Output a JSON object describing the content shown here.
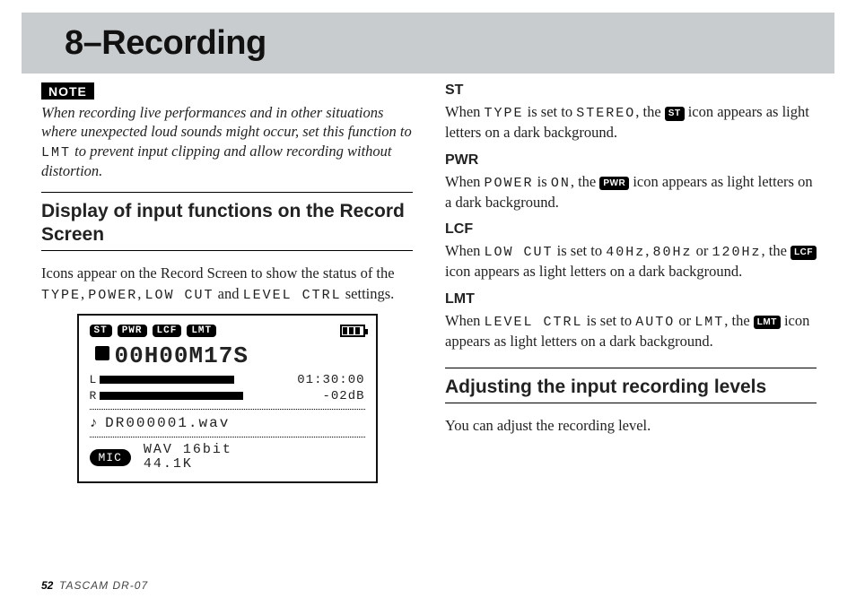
{
  "header": {
    "chapter": "8–Recording"
  },
  "left": {
    "note_tag": "NOTE",
    "note_text_a": "When recording live performances and in other situations where unexpected loud sounds might occur, set this function to ",
    "note_code": "LMT",
    "note_text_b": " to prevent input clipping and allow recording without distortion.",
    "section_title": "Display of input functions on the Record Screen",
    "para_a": "Icons appear on the Record Screen to show the status of the ",
    "c1": "TYPE",
    "sep1": ", ",
    "c2": "POWER",
    "sep2": ", ",
    "c3": "LOW CUT",
    "sep3": " and ",
    "c4": "LEVEL CTRL",
    "para_b": " settings."
  },
  "lcd": {
    "chips": [
      "ST",
      "PWR",
      "LCF",
      "LMT"
    ],
    "time": "00H00M17S",
    "l_label": "L",
    "r_label": "R",
    "remain": "01:30:00",
    "db": "-02dB",
    "filename": "DR000001.wav",
    "mic": "MIC",
    "format1": "WAV 16bit",
    "format2": "44.1K"
  },
  "right": {
    "st": {
      "hd": "ST",
      "a": "When ",
      "c1": "TYPE",
      "b": " is set to ",
      "c2": "STEREO",
      "c": ", the ",
      "icon": "ST",
      "d": " icon appears as light letters on a dark background."
    },
    "pwr": {
      "hd": "PWR",
      "a": "When ",
      "c1": "POWER",
      "b": " is ",
      "c2": "ON",
      "c": ", the ",
      "icon": "PWR",
      "d": " icon appears as light letters on a dark background."
    },
    "lcf": {
      "hd": "LCF",
      "a": "When ",
      "c1": "LOW CUT",
      "b": " is set to ",
      "v1": "40Hz",
      "s1": ", ",
      "v2": "80Hz",
      "s2": " or ",
      "v3": "120Hz",
      "c": ", the ",
      "icon": "LCF",
      "d": " icon appears as light letters on a dark background."
    },
    "lmt": {
      "hd": "LMT",
      "a": "When ",
      "c1": "LEVEL CTRL",
      "b": " is set to ",
      "v1": "AUTO",
      "s1": " or ",
      "v2": "LMT",
      "c": ", the ",
      "icon": "LMT",
      "d": " icon appears as light letters on a dark background."
    },
    "section2": "Adjusting the input recording levels",
    "para2": "You can adjust the recording level."
  },
  "footer": {
    "page": "52",
    "product": "TASCAM  DR-07"
  }
}
